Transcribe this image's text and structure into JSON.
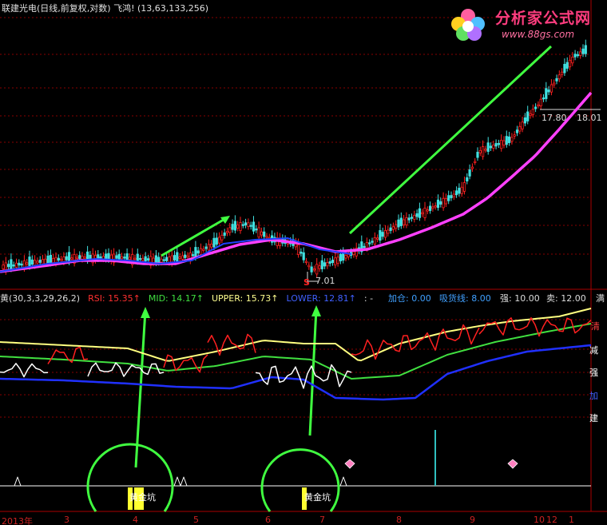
{
  "header": {
    "stock": "联建光电(日线,前复权,对数)",
    "indicator": "飞鸿",
    "params": "(13,63,133,256)"
  },
  "logo": {
    "name": "分析家公式网",
    "url": "www.88gs.com"
  },
  "price_labels": {
    "low": "7.01",
    "high_a": "17.80",
    "high_b": "18.01",
    "marker": "S"
  },
  "indicator_row": {
    "name": "黄(30,3,3,29,26,2)",
    "rsi": "RSI: 15.35↑",
    "mid": "MID: 14.17↑",
    "upper": "UPPER: 15.73↑",
    "lower": "LOWER: 12.81↑",
    "dash": ": -",
    "jiacang": "加仓: 0.00",
    "xihuo": "吸货线: 8.00",
    "qiang": "强: 10.00",
    "mai": "卖: 12.00",
    "tail": "满"
  },
  "right_labels": {
    "qing": "清",
    "jian": "减",
    "qiang": "强",
    "jia": "加",
    "jian2": "建"
  },
  "signals": {
    "a": "黄金坑",
    "b": "黄金坑"
  },
  "x_axis": [
    "2013年",
    "3",
    "4",
    "5",
    "6",
    "7",
    "8",
    "9",
    "10",
    "12",
    "1"
  ],
  "colors": {
    "ma_long": "#ff40ff",
    "ma_mid": "#2040ff",
    "upper": "#ffff80",
    "mid": "#40e040",
    "lower": "#2030ff",
    "rsi_up": "#ff2020",
    "rsi_down": "#ffffff",
    "arrow": "#40ff40",
    "grid": "#880000"
  }
}
